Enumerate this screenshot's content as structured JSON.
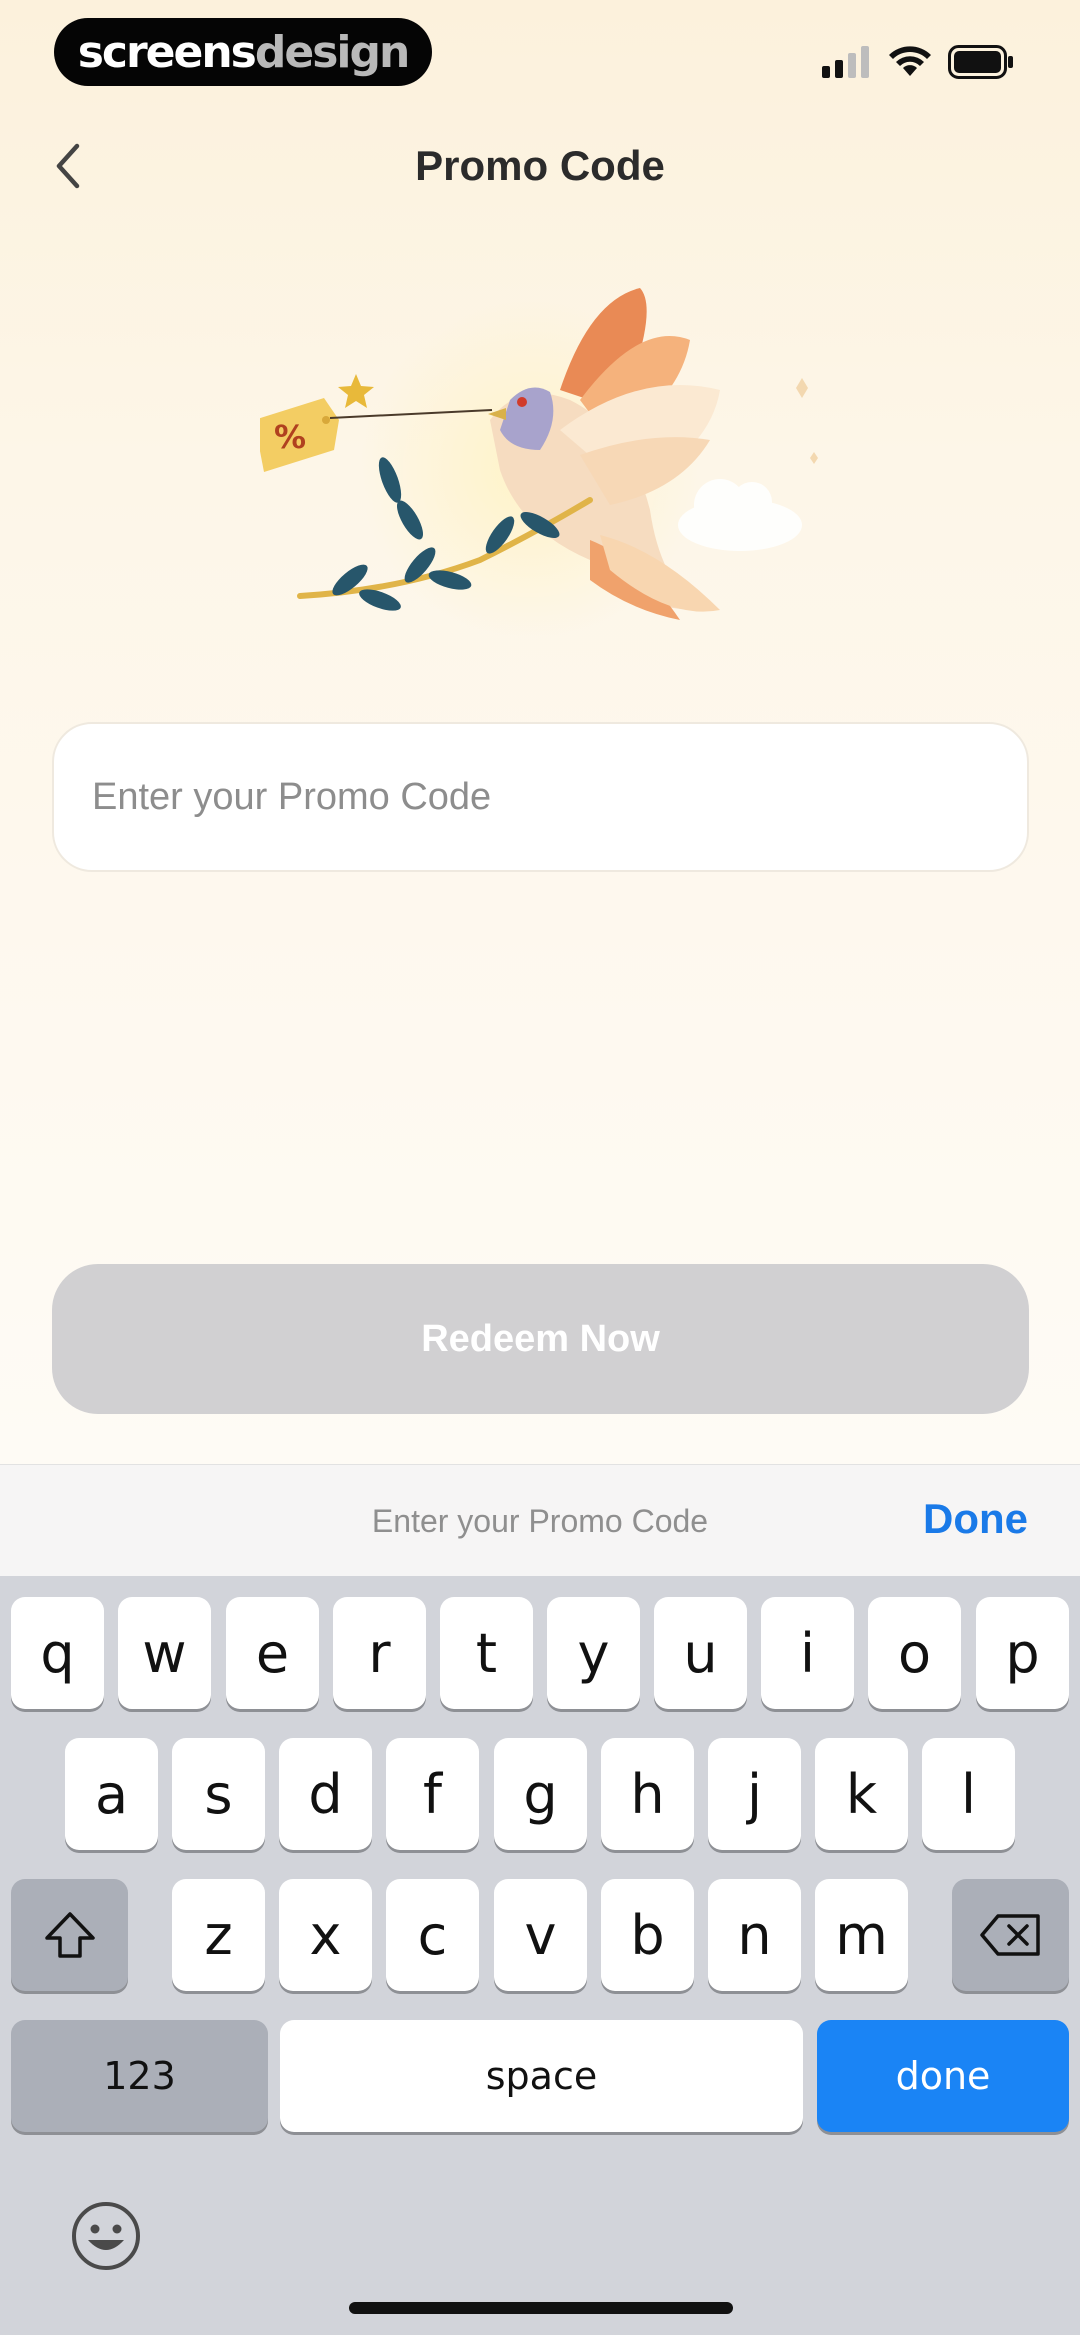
{
  "status_bar": {
    "watermark_bold": "screens",
    "watermark_light": "design"
  },
  "nav": {
    "title": "Promo Code",
    "back_icon": "chevron-left-icon"
  },
  "form": {
    "promo_placeholder": "Enter your Promo Code",
    "promo_value": "",
    "redeem_label": "Redeem Now"
  },
  "accessory": {
    "hint": "Enter your Promo Code",
    "done_label": "Done"
  },
  "keyboard": {
    "row1": [
      "q",
      "w",
      "e",
      "r",
      "t",
      "y",
      "u",
      "i",
      "o",
      "p"
    ],
    "row2": [
      "a",
      "s",
      "d",
      "f",
      "g",
      "h",
      "j",
      "k",
      "l"
    ],
    "row3": [
      "z",
      "x",
      "c",
      "v",
      "b",
      "n",
      "m"
    ],
    "numbers_label": "123",
    "space_label": "space",
    "return_label": "done",
    "shift_icon": "shift-icon",
    "delete_icon": "delete-icon",
    "emoji_icon": "emoji-icon"
  },
  "colors": {
    "accent_blue": "#1a84f5",
    "disabled_button": "#d1d0d2",
    "background": "#fdf6e8"
  }
}
